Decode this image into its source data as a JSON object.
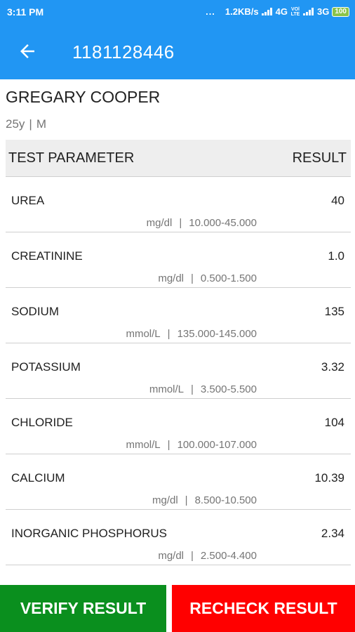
{
  "status_bar": {
    "time": "3:11 PM",
    "dots": "...",
    "speed": "1.2KB/s",
    "net1": "4G",
    "volte": "VOl LTE",
    "net2": "3G",
    "battery": "100"
  },
  "appbar": {
    "title": "1181128446",
    "back_icon": "arrow-back-icon"
  },
  "patient": {
    "name": "GREGARY COOPER",
    "age": "25y",
    "separator": "|",
    "sex": "M"
  },
  "table": {
    "header": {
      "parameter": "TEST PARAMETER",
      "result": "RESULT"
    },
    "rows": [
      {
        "name": "UREA",
        "value": "40",
        "unit": "mg/dl",
        "range": "10.000-45.000"
      },
      {
        "name": "CREATININE",
        "value": "1.0",
        "unit": "mg/dl",
        "range": "0.500-1.500"
      },
      {
        "name": "SODIUM",
        "value": "135",
        "unit": "mmol/L",
        "range": "135.000-145.000"
      },
      {
        "name": "POTASSIUM",
        "value": "3.32",
        "unit": "mmol/L",
        "range": "3.500-5.500"
      },
      {
        "name": "CHLORIDE",
        "value": "104",
        "unit": "mmol/L",
        "range": "100.000-107.000"
      },
      {
        "name": "CALCIUM",
        "value": "10.39",
        "unit": "mg/dl",
        "range": "8.500-10.500"
      },
      {
        "name": "INORGANIC PHOSPHORUS",
        "value": "2.34",
        "unit": "mg/dl",
        "range": "2.500-4.400"
      }
    ]
  },
  "actions": {
    "verify_label": "VERIFY RESULT",
    "recheck_label": "RECHECK RESULT"
  },
  "colors": {
    "primary": "#2196f3",
    "verify": "#0a8f1e",
    "recheck": "#ff0000"
  }
}
